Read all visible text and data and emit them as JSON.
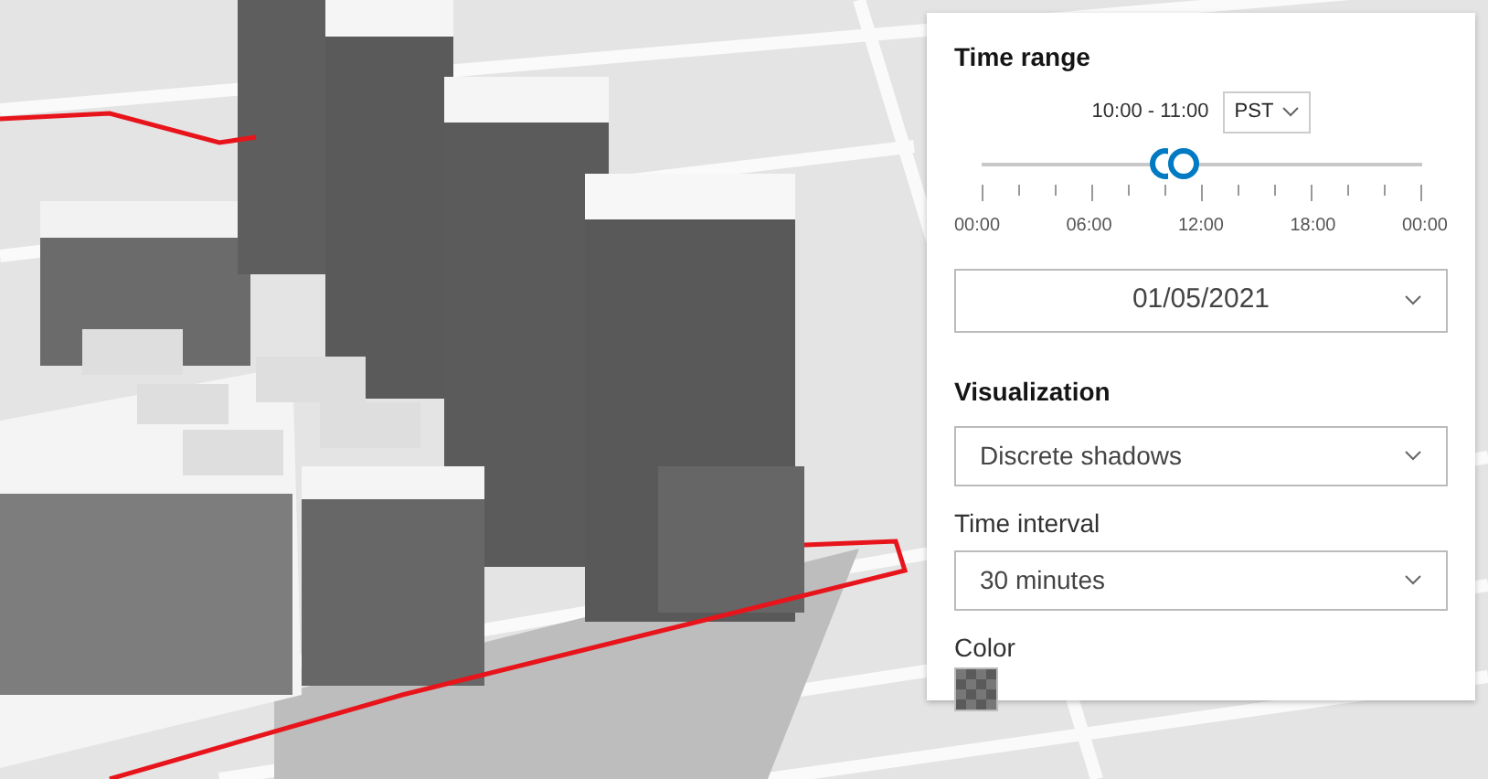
{
  "panel": {
    "title": "Time range",
    "time_range": {
      "reading": "10:00 - 11:00",
      "timezone": "PST"
    },
    "slider": {
      "thumbs": [
        {
          "level": 0.4167
        },
        {
          "level": 0.4583
        }
      ],
      "labels": [
        "00:00",
        "06:00",
        "12:00",
        "18:00",
        "00:00"
      ]
    },
    "date": "01/05/2021",
    "visualization": {
      "title": "Visualization",
      "value": "Discrete shadows"
    },
    "time_interval": {
      "label": "Time interval",
      "value": "30 minutes"
    },
    "color": {
      "label": "Color"
    }
  }
}
